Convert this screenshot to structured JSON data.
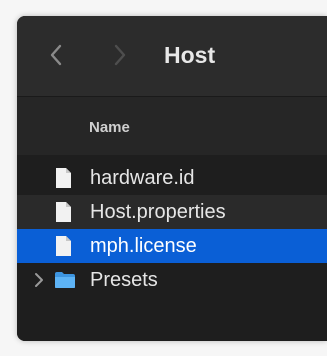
{
  "window": {
    "title": "Host"
  },
  "toolbar": {
    "back_icon": "chevron-left-icon",
    "forward_icon": "chevron-right-icon"
  },
  "columns": {
    "name_header": "Name"
  },
  "files": [
    {
      "label": "hardware.id",
      "icon": "document-icon",
      "selected": false
    },
    {
      "label": "Host.properties",
      "icon": "document-icon",
      "selected": false
    },
    {
      "label": "mph.license",
      "icon": "document-icon",
      "selected": true
    },
    {
      "label": "Presets",
      "icon": "folder-icon",
      "selected": false,
      "expandable": true
    }
  ],
  "colors": {
    "selection": "#0a5fd6",
    "folder": "#4aa8f0",
    "background": "#1e1e1e"
  }
}
